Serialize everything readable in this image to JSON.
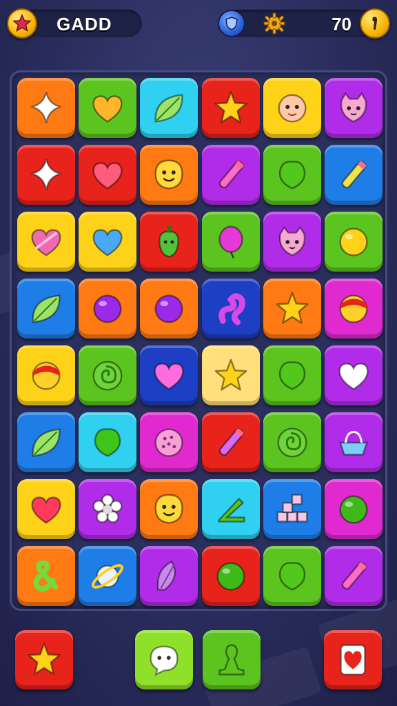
{
  "header": {
    "title": "GADD",
    "score": "70",
    "left_icon": "star-coin-icon",
    "right_icon": "pin-coin-icon",
    "badge_icon": "shield-badge-icon",
    "gear_icon": "gear-icon"
  },
  "colors": {
    "orange": "#ff7a12",
    "green": "#5cc41f",
    "cyan": "#2fd0f0",
    "red": "#e8231c",
    "yellow": "#ffd21a",
    "purple": "#b12ce8",
    "blue": "#1f7de8",
    "magenta": "#e02ad0",
    "navy": "#1c3fc4",
    "cream": "#ffe07a",
    "lime": "#8ee02a"
  },
  "board": {
    "rows": [
      [
        {
          "color": "orange",
          "icon": "sparkle-star-icon"
        },
        {
          "color": "green",
          "icon": "heart-icon"
        },
        {
          "color": "cyan",
          "icon": "leaf-icon"
        },
        {
          "color": "red",
          "icon": "star-icon"
        },
        {
          "color": "yellow",
          "icon": "face-icon"
        },
        {
          "color": "purple",
          "icon": "cat-face-icon"
        }
      ],
      [
        {
          "color": "red",
          "icon": "sparkle-star-icon"
        },
        {
          "color": "red",
          "icon": "heart-icon"
        },
        {
          "color": "orange",
          "icon": "smiley-icon"
        },
        {
          "color": "purple",
          "icon": "pencil-icon"
        },
        {
          "color": "green",
          "icon": "leaf-blob-icon"
        },
        {
          "color": "blue",
          "icon": "pencil-icon"
        }
      ],
      [
        {
          "color": "yellow",
          "icon": "candy-heart-icon"
        },
        {
          "color": "yellow",
          "icon": "heart-icon"
        },
        {
          "color": "red",
          "icon": "pepper-icon"
        },
        {
          "color": "green",
          "icon": "balloon-icon"
        },
        {
          "color": "purple",
          "icon": "cat-face-icon"
        },
        {
          "color": "green",
          "icon": "ball-icon"
        }
      ],
      [
        {
          "color": "blue",
          "icon": "leaf-icon"
        },
        {
          "color": "orange",
          "icon": "ball-icon"
        },
        {
          "color": "orange",
          "icon": "ball-icon"
        },
        {
          "color": "navy",
          "icon": "squiggle-icon"
        },
        {
          "color": "orange",
          "icon": "star-icon"
        },
        {
          "color": "magenta",
          "icon": "candy-ball-icon"
        }
      ],
      [
        {
          "color": "yellow",
          "icon": "candy-ball-icon"
        },
        {
          "color": "green",
          "icon": "swirl-icon"
        },
        {
          "color": "navy",
          "icon": "heart-icon"
        },
        {
          "color": "cream",
          "icon": "star-icon"
        },
        {
          "color": "green",
          "icon": "leaf-blob-icon"
        },
        {
          "color": "purple",
          "icon": "heart-icon"
        }
      ],
      [
        {
          "color": "blue",
          "icon": "leaf-icon"
        },
        {
          "color": "cyan",
          "icon": "leaf-blob-icon"
        },
        {
          "color": "magenta",
          "icon": "cookie-icon"
        },
        {
          "color": "red",
          "icon": "pencil-icon"
        },
        {
          "color": "green",
          "icon": "swirl-icon"
        },
        {
          "color": "purple",
          "icon": "basket-icon"
        }
      ],
      [
        {
          "color": "yellow",
          "icon": "heart-icon"
        },
        {
          "color": "purple",
          "icon": "flower-icon"
        },
        {
          "color": "orange",
          "icon": "smiley-icon"
        },
        {
          "color": "cyan",
          "icon": "triangle-icon"
        },
        {
          "color": "blue",
          "icon": "blocks-icon"
        },
        {
          "color": "magenta",
          "icon": "ball-icon"
        }
      ],
      [
        {
          "color": "orange",
          "icon": "ampersand-icon"
        },
        {
          "color": "blue",
          "icon": "planet-icon"
        },
        {
          "color": "purple",
          "icon": "feather-icon"
        },
        {
          "color": "red",
          "icon": "ball-icon"
        },
        {
          "color": "green",
          "icon": "leaf-blob-icon"
        },
        {
          "color": "purple",
          "icon": "pencil-icon"
        }
      ]
    ]
  },
  "bottom": {
    "buttons": [
      {
        "name": "star-button",
        "color": "red",
        "icon": "star-icon"
      },
      {
        "name": "chat-button",
        "color": "lime",
        "icon": "chat-bubble-icon"
      },
      {
        "name": "pawn-button",
        "color": "green",
        "icon": "pawn-icon"
      },
      {
        "name": "card-button",
        "color": "red",
        "icon": "heart-card-icon"
      }
    ]
  }
}
